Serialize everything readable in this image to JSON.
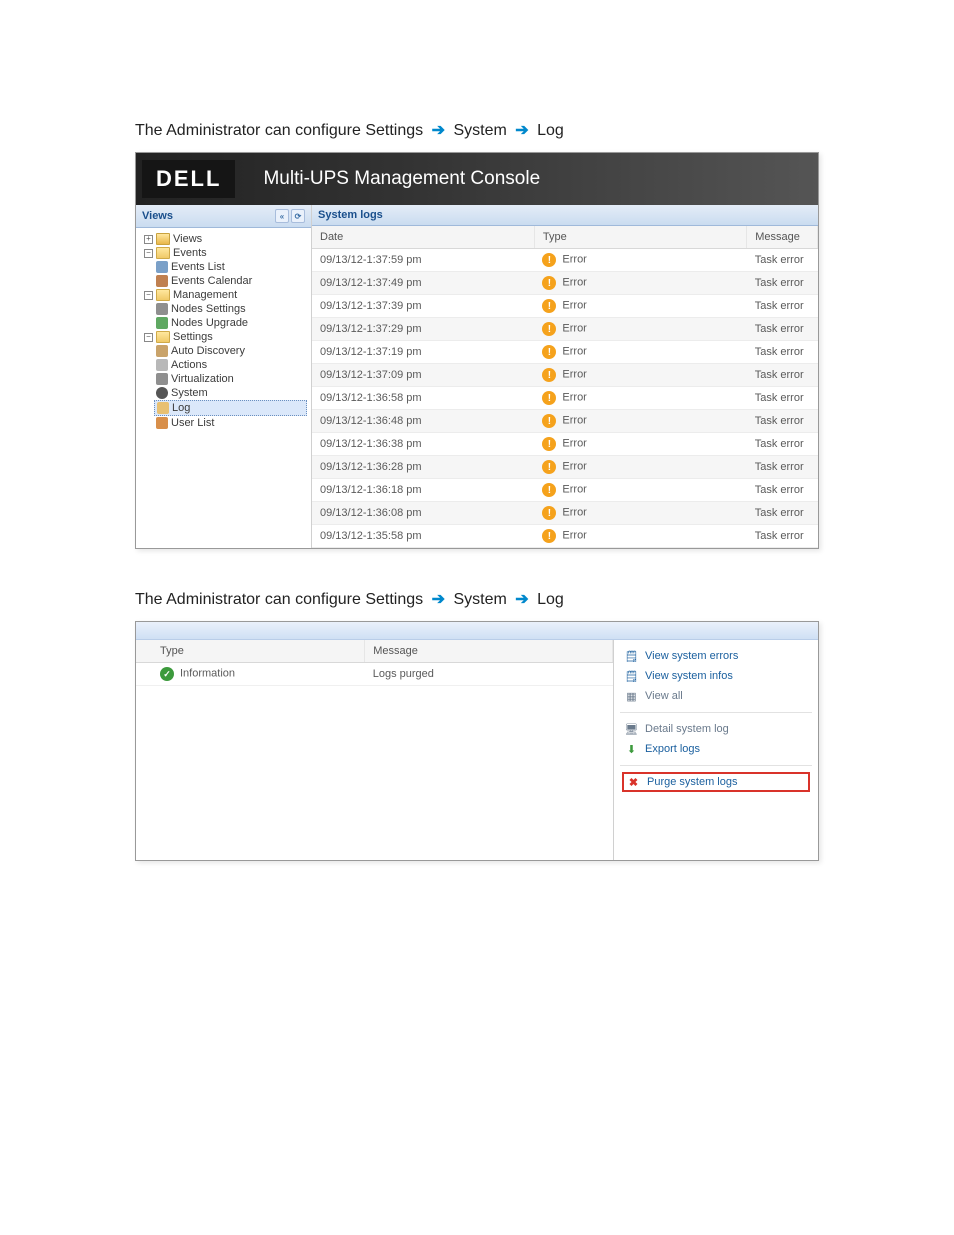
{
  "doc_text_1_prefix": "The Administrator can configure ",
  "doc_text_1_path": [
    "Settings",
    "System",
    "Log"
  ],
  "app_title": "Multi-UPS Management Console",
  "brand": "DELL",
  "views_label": "Views",
  "panel_title": "System logs",
  "tree": {
    "views": "Views",
    "events": "Events",
    "events_list": "Events List",
    "events_cal": "Events Calendar",
    "management": "Management",
    "nodes_settings": "Nodes Settings",
    "nodes_upgrade": "Nodes Upgrade",
    "settings": "Settings",
    "auto_discovery": "Auto Discovery",
    "actions": "Actions",
    "virtualization": "Virtualization",
    "system": "System",
    "log": "Log",
    "user_list": "User List"
  },
  "cols1": {
    "date": "Date",
    "type": "Type",
    "message": "Message"
  },
  "rows1": [
    {
      "date": "09/13/12-1:37:59 pm",
      "type": "Error",
      "message": "Task error"
    },
    {
      "date": "09/13/12-1:37:49 pm",
      "type": "Error",
      "message": "Task error"
    },
    {
      "date": "09/13/12-1:37:39 pm",
      "type": "Error",
      "message": "Task error"
    },
    {
      "date": "09/13/12-1:37:29 pm",
      "type": "Error",
      "message": "Task error"
    },
    {
      "date": "09/13/12-1:37:19 pm",
      "type": "Error",
      "message": "Task error"
    },
    {
      "date": "09/13/12-1:37:09 pm",
      "type": "Error",
      "message": "Task error"
    },
    {
      "date": "09/13/12-1:36:58 pm",
      "type": "Error",
      "message": "Task error"
    },
    {
      "date": "09/13/12-1:36:48 pm",
      "type": "Error",
      "message": "Task error"
    },
    {
      "date": "09/13/12-1:36:38 pm",
      "type": "Error",
      "message": "Task error"
    },
    {
      "date": "09/13/12-1:36:28 pm",
      "type": "Error",
      "message": "Task error"
    },
    {
      "date": "09/13/12-1:36:18 pm",
      "type": "Error",
      "message": "Task error"
    },
    {
      "date": "09/13/12-1:36:08 pm",
      "type": "Error",
      "message": "Task error"
    },
    {
      "date": "09/13/12-1:35:58 pm",
      "type": "Error",
      "message": "Task error"
    }
  ],
  "doc_text_2_prefix": "The Administrator can configure ",
  "doc_text_2_path": [
    "Settings",
    "System",
    "Log"
  ],
  "cols2": {
    "type": "Type",
    "message": "Message"
  },
  "rows2": [
    {
      "type": "Information",
      "message": "Logs purged"
    }
  ],
  "actions": {
    "view_errors": "View system errors",
    "view_infos": "View system infos",
    "view_all": "View all",
    "detail": "Detail system log",
    "export": "Export logs",
    "purge": "Purge system logs"
  }
}
